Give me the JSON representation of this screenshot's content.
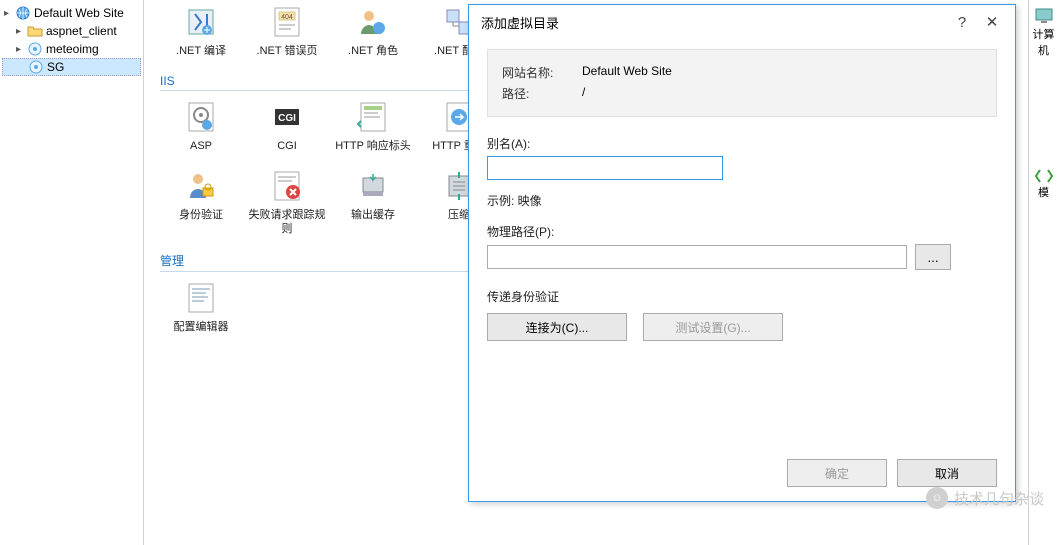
{
  "tree": {
    "items": [
      {
        "label": "Default Web Site",
        "icon": "globe",
        "indent": 0,
        "exp": "▸",
        "selected": false
      },
      {
        "label": "aspnet_client",
        "icon": "folder",
        "indent": 1,
        "exp": "▸",
        "selected": false
      },
      {
        "label": "meteoimg",
        "icon": "app",
        "indent": 1,
        "exp": "▸",
        "selected": false
      },
      {
        "label": "SG",
        "icon": "app",
        "indent": 1,
        "exp": "",
        "selected": true
      }
    ]
  },
  "topRow": [
    {
      "label": ".NET 编译",
      "name": "net-compile-icon"
    },
    {
      "label": ".NET 错误页",
      "name": "net-error-icon"
    },
    {
      "label": ".NET 角色",
      "name": "net-roles-icon"
    },
    {
      "label": ".NET 配件",
      "name": "net-assembly-icon"
    },
    {
      "label": "",
      "name": "globe-icon"
    },
    {
      "label": "",
      "name": "security-icon"
    },
    {
      "label": "",
      "name": "globe-shield-icon"
    },
    {
      "label": "",
      "name": "users-icon"
    },
    {
      "label": "",
      "name": "monitor-icon"
    },
    {
      "label": "",
      "name": "user-color-icon"
    }
  ],
  "sections": {
    "iis": {
      "title": "IIS",
      "row1": [
        {
          "label": "ASP",
          "name": "asp-icon"
        },
        {
          "label": "CGI",
          "name": "cgi-icon"
        },
        {
          "label": "HTTP 响应标头",
          "name": "http-headers-icon"
        },
        {
          "label": "HTTP 重向",
          "name": "http-redirect-icon"
        }
      ],
      "row2": [
        {
          "label": "身份验证",
          "name": "auth-icon"
        },
        {
          "label": "失败请求跟踪规则",
          "name": "failed-trace-icon"
        },
        {
          "label": "输出缓存",
          "name": "output-cache-icon"
        },
        {
          "label": "压缩",
          "name": "compression-icon"
        }
      ]
    },
    "mgmt": {
      "title": "管理",
      "items": [
        {
          "label": "配置编辑器",
          "name": "config-editor-icon"
        }
      ]
    }
  },
  "rightStrip": {
    "top": "计算机",
    "template": "模"
  },
  "dialog": {
    "title": "添加虚拟目录",
    "help": "?",
    "siteLabel": "网站名称:",
    "siteValue": "Default Web Site",
    "pathLabel": "路径:",
    "pathValue": "/",
    "alias": "别名(A):",
    "aliasValue": "",
    "example": "示例: 映像",
    "physPath": "物理路径(P):",
    "physPathValue": "",
    "browseBtn": "...",
    "passthrough": "传递身份验证",
    "connectAs": "连接为(C)...",
    "testSettings": "测试设置(G)...",
    "ok": "确定",
    "cancel": "取消"
  },
  "watermark": "技术几句杂谈"
}
